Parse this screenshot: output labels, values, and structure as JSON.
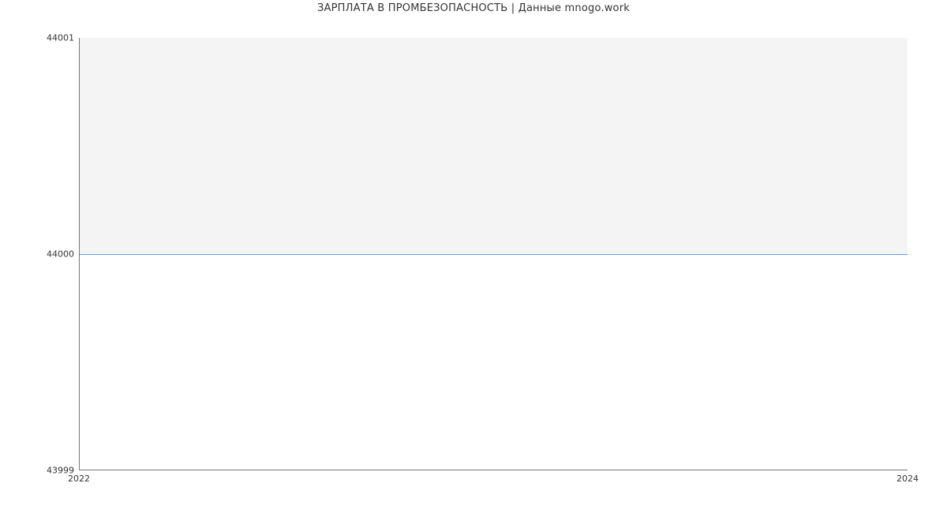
{
  "chart_data": {
    "type": "line",
    "title": "ЗАРПЛАТА В ПРОМБЕЗОПАСНОСТЬ | Данные mnogo.work",
    "xlabel": "",
    "ylabel": "",
    "x": [
      2022,
      2024
    ],
    "values": [
      44000,
      44000
    ],
    "xlim": [
      2022,
      2024
    ],
    "ylim": [
      43999,
      44001
    ],
    "xticks": [
      "2022",
      "2024"
    ],
    "yticks": [
      "43999",
      "44000",
      "44001"
    ],
    "series_color": "#5b9bd5"
  }
}
